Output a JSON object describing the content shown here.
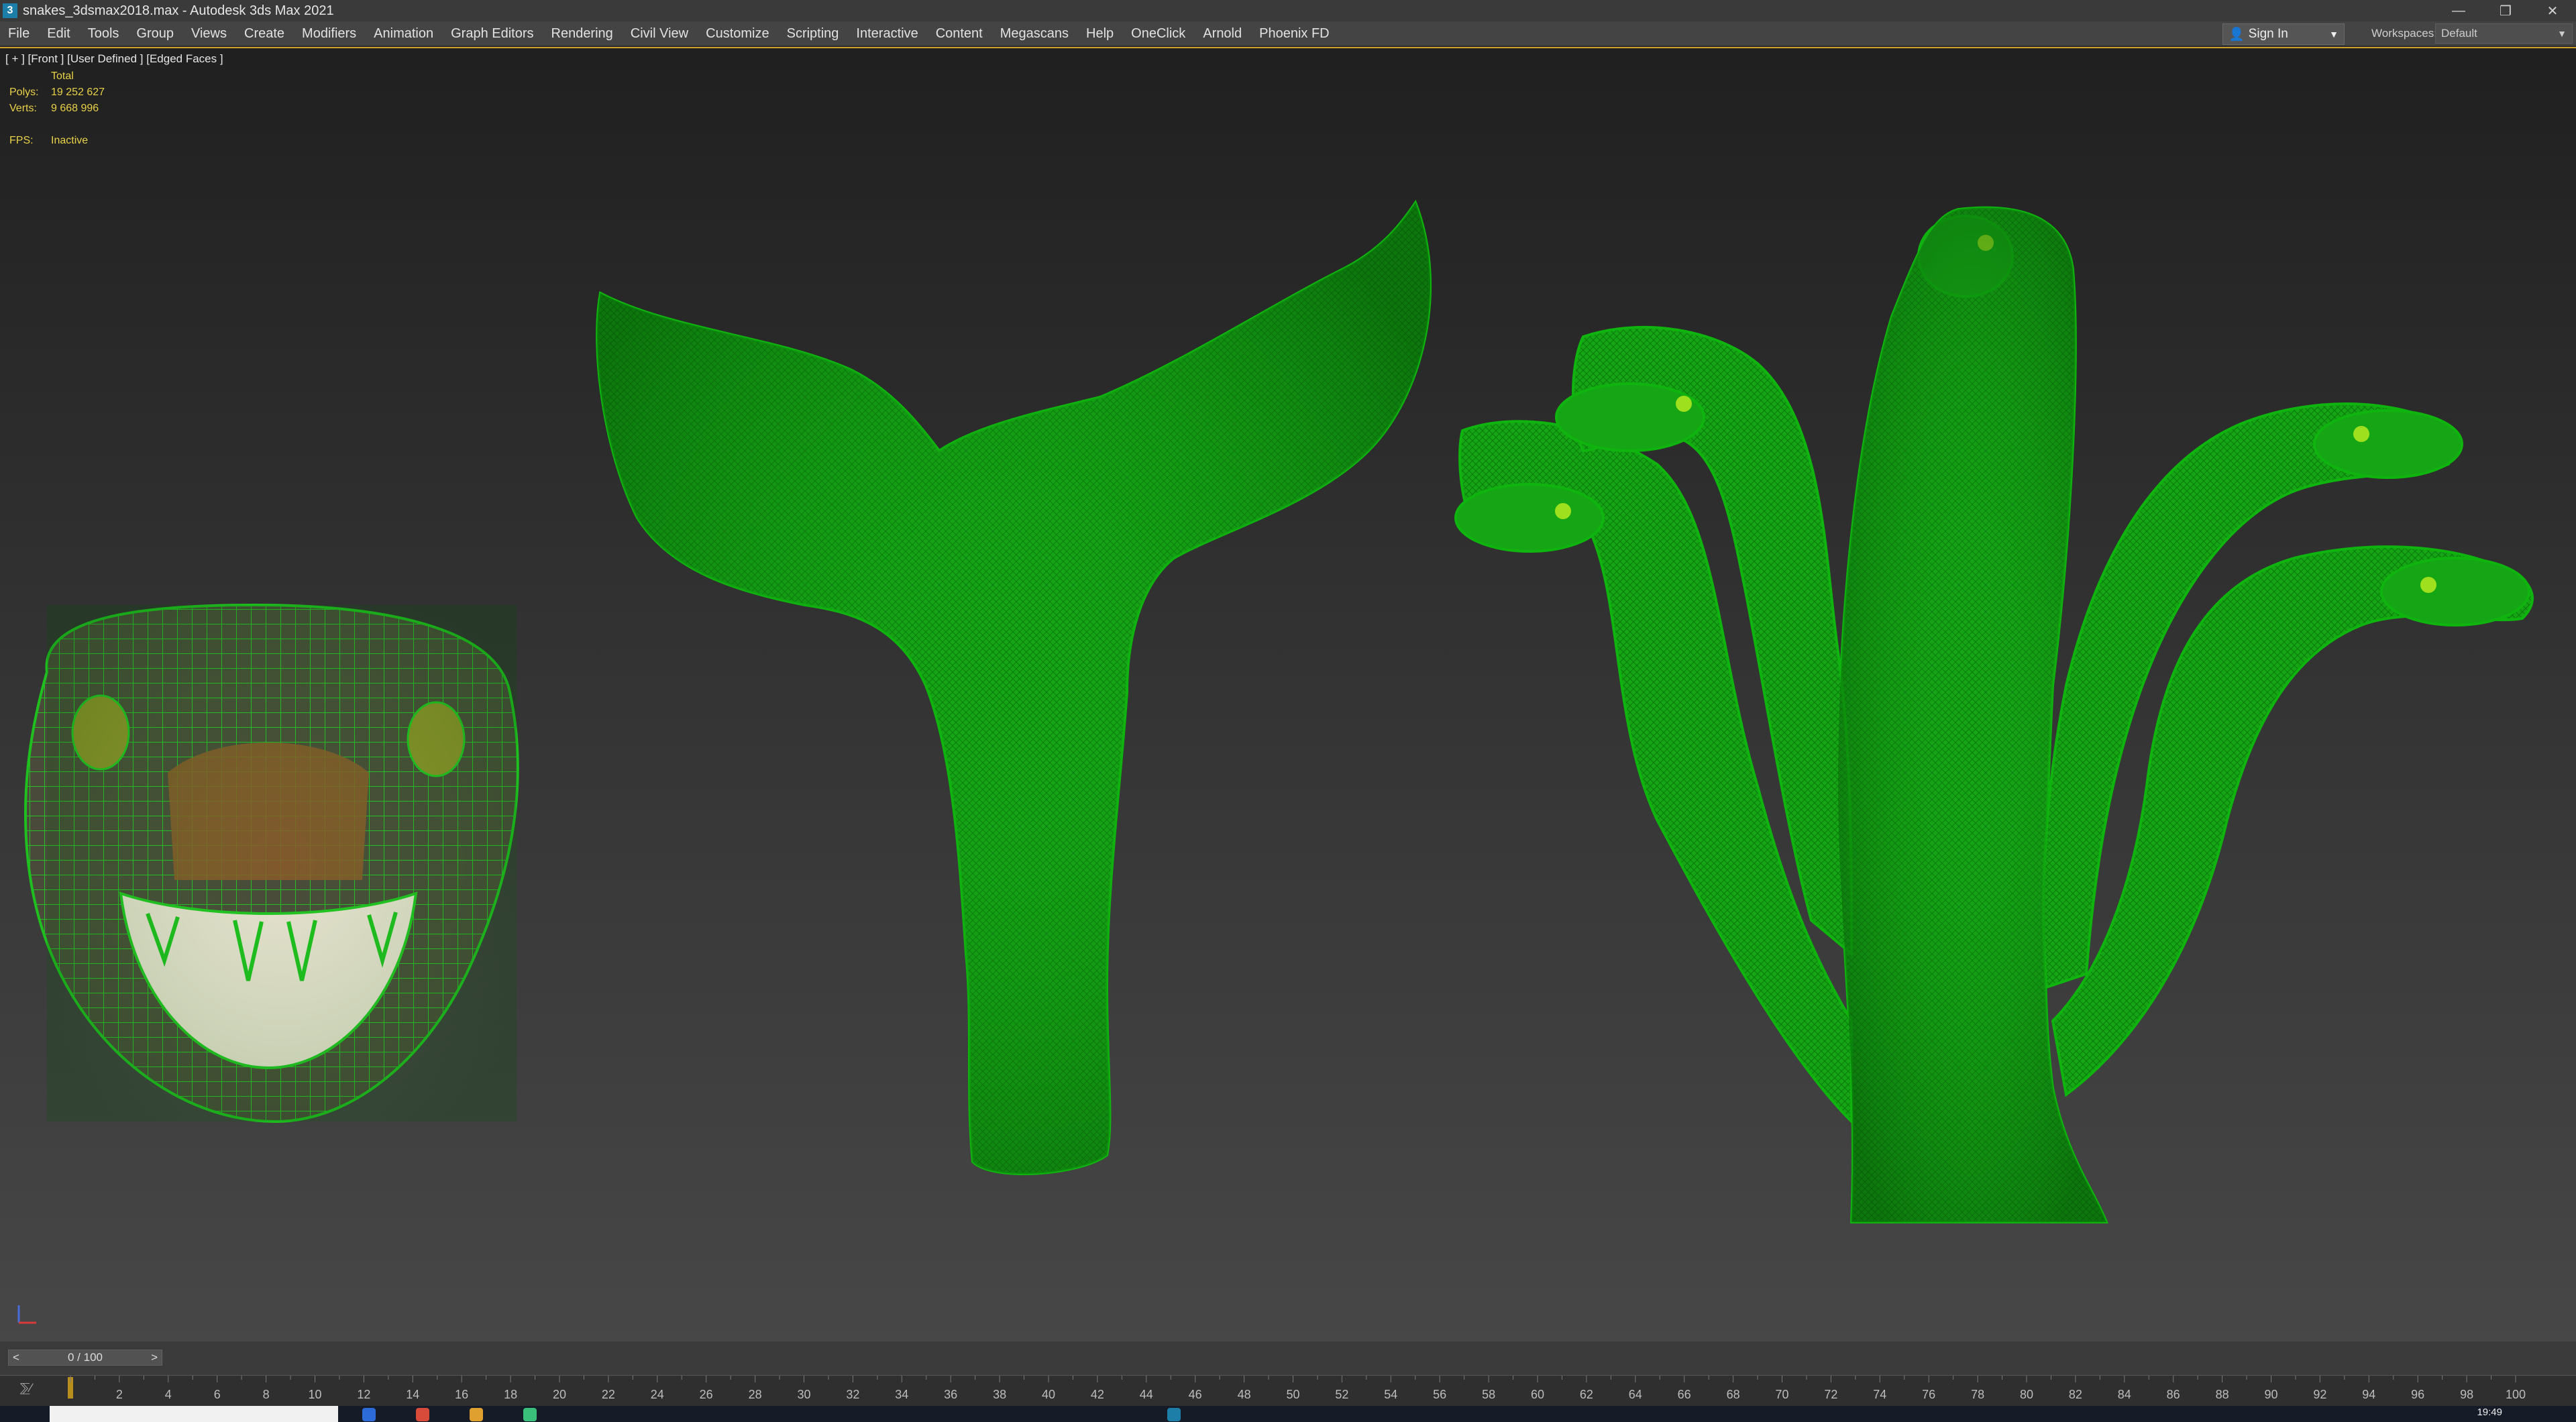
{
  "window": {
    "title": "snakes_3dsmax2018.max - Autodesk 3ds Max 2021",
    "app_icon": "3",
    "controls": [
      "—",
      "❐",
      "✕"
    ]
  },
  "menu": {
    "items": [
      "File",
      "Edit",
      "Tools",
      "Group",
      "Views",
      "Create",
      "Modifiers",
      "Animation",
      "Graph Editors",
      "Rendering",
      "Civil View",
      "Customize",
      "Scripting",
      "Interactive",
      "Content",
      "Megascans",
      "Help",
      "OneClick",
      "Arnold",
      "Phoenix FD"
    ],
    "sign_in": "Sign In",
    "workspaces_label": "Workspaces:",
    "workspace_value": "Default"
  },
  "viewport": {
    "label": "[ + ] [Front ] [User Defined ] [Edged Faces ]",
    "stats": {
      "header": "Total",
      "polys_label": "Polys:",
      "polys_value": "19 252 627",
      "verts_label": "Verts:",
      "verts_value": "9 668 996",
      "fps_label": "FPS:",
      "fps_value": "Inactive"
    },
    "colors": {
      "wire": "#0fae0f",
      "wire_dark": "#0a8a0a",
      "selection_border": "#c9a227"
    }
  },
  "timeline": {
    "frame_readout": "0 / 100",
    "prev": "<",
    "next": ">",
    "ticks": [
      "2",
      "4",
      "6",
      "8",
      "10",
      "12",
      "14",
      "16",
      "18",
      "20",
      "22",
      "24",
      "26",
      "28",
      "30",
      "32",
      "34",
      "36",
      "38",
      "40",
      "42",
      "44",
      "46",
      "48",
      "50",
      "52",
      "54",
      "56",
      "58",
      "60",
      "62",
      "64",
      "66",
      "68",
      "70",
      "72",
      "74",
      "76",
      "78",
      "80",
      "82",
      "84",
      "86",
      "88",
      "90",
      "92",
      "94",
      "96",
      "98",
      "100"
    ]
  },
  "taskbar": {
    "clock": "19:49"
  }
}
